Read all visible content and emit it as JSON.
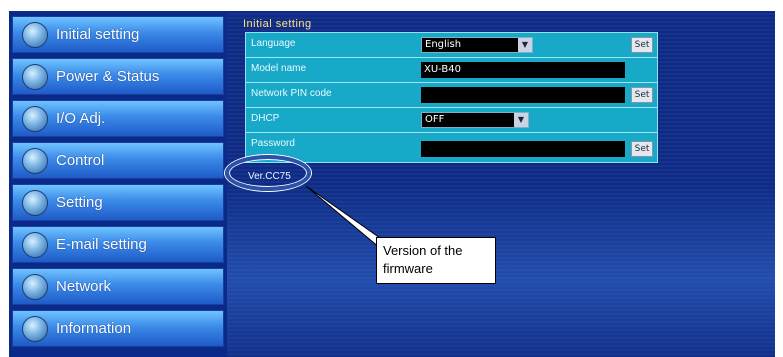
{
  "sidebar": {
    "items": [
      {
        "label": "Initial setting",
        "icon": "globe-icon"
      },
      {
        "label": "Power & Status",
        "icon": "globe-icon"
      },
      {
        "label": "I/O Adj.",
        "icon": "globe-icon"
      },
      {
        "label": "Control",
        "icon": "globe-icon"
      },
      {
        "label": "Setting",
        "icon": "globe-icon"
      },
      {
        "label": "E-mail setting",
        "icon": "globe-icon"
      },
      {
        "label": "Network",
        "icon": "globe-icon"
      },
      {
        "label": "Information",
        "icon": "globe-icon"
      }
    ]
  },
  "main": {
    "title": "Initial setting",
    "rows": {
      "language": {
        "label": "Language",
        "value": "English",
        "button": "Set"
      },
      "model_name": {
        "label": "Model name",
        "value": "XU-B40"
      },
      "network_pin": {
        "label": "Network PIN code",
        "value": "",
        "button": "Set"
      },
      "dhcp": {
        "label": "DHCP",
        "value": "OFF"
      },
      "password": {
        "label": "Password",
        "value": "",
        "button": "Set"
      }
    },
    "version": "Ver.CC75"
  },
  "annotation": {
    "callout_text": "Version of the firmware"
  },
  "colors": {
    "accent_yellow": "#ffe27a",
    "table_teal": "#18a8c8",
    "callout_blue": "#2a52a8"
  }
}
